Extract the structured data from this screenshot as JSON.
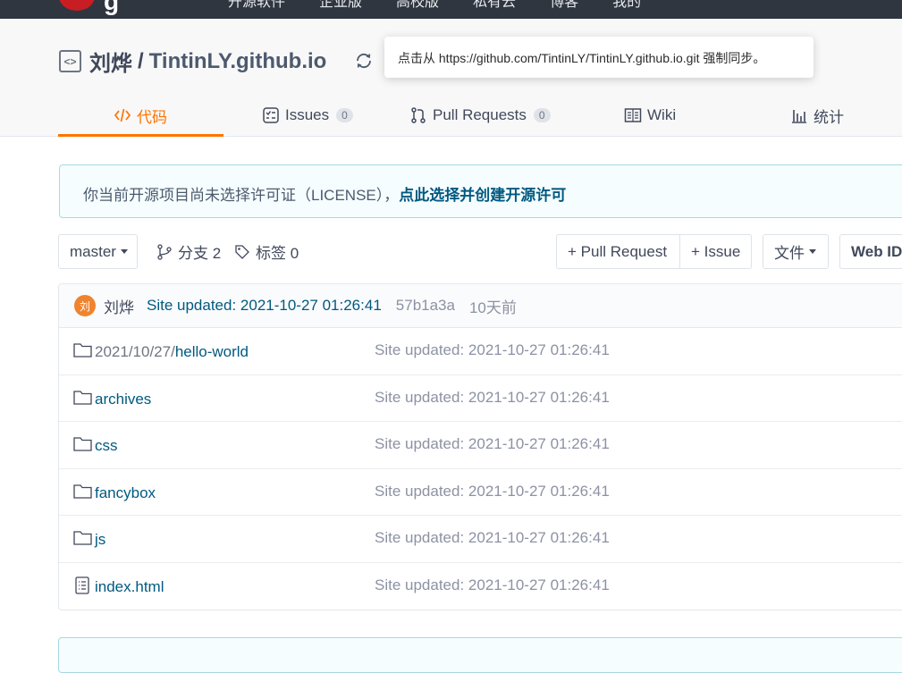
{
  "topbar": {
    "logo_letter": "g",
    "nav": [
      "开源软件",
      "企业版",
      "高校版",
      "私有云",
      "博客",
      "我的"
    ]
  },
  "repo": {
    "owner": "刘烨",
    "separator": "/",
    "name": "TintinLY.github.io",
    "sync_tooltip": "点击从 https://github.com/TintinLY/TintinLY.github.io.git 强制同步。"
  },
  "tabs": [
    {
      "label": "代码",
      "icon": "code-icon",
      "active": true
    },
    {
      "label": "Issues",
      "badge": "0",
      "icon": "issues-icon"
    },
    {
      "label": "Pull Requests",
      "badge": "0",
      "icon": "pull-request-icon"
    },
    {
      "label": "Wiki",
      "icon": "book-icon"
    },
    {
      "label": "统计",
      "icon": "bar-chart-icon"
    }
  ],
  "license": {
    "text": "你当前开源项目尚未选择许可证（LICENSE），",
    "link": "点此选择并创建开源许可"
  },
  "toolbar": {
    "branch": "master",
    "branches": "分支 2",
    "tags": "标签 0",
    "pull_request": "+ Pull Request",
    "issue": "+ Issue",
    "file": "文件",
    "webide": "Web IDE"
  },
  "commit": {
    "avatar": "刘",
    "author": "刘烨",
    "message": "Site updated: 2021-10-27 01:26:41",
    "sha": "57b1a3a",
    "time": "10天前"
  },
  "files": [
    {
      "prefix": "2021/10/27/",
      "name": "hello-world",
      "type": "folder",
      "message": "Site updated: 2021-10-27 01:26:41"
    },
    {
      "prefix": "",
      "name": "archives",
      "type": "folder",
      "message": "Site updated: 2021-10-27 01:26:41"
    },
    {
      "prefix": "",
      "name": "css",
      "type": "folder",
      "message": "Site updated: 2021-10-27 01:26:41"
    },
    {
      "prefix": "",
      "name": "fancybox",
      "type": "folder",
      "message": "Site updated: 2021-10-27 01:26:41"
    },
    {
      "prefix": "",
      "name": "js",
      "type": "folder",
      "message": "Site updated: 2021-10-27 01:26:41"
    },
    {
      "prefix": "",
      "name": "index.html",
      "type": "file",
      "message": "Site updated: 2021-10-27 01:26:41"
    }
  ],
  "colors": {
    "accent": "#fe7300",
    "link": "#005980",
    "brand": "#c71d23"
  }
}
